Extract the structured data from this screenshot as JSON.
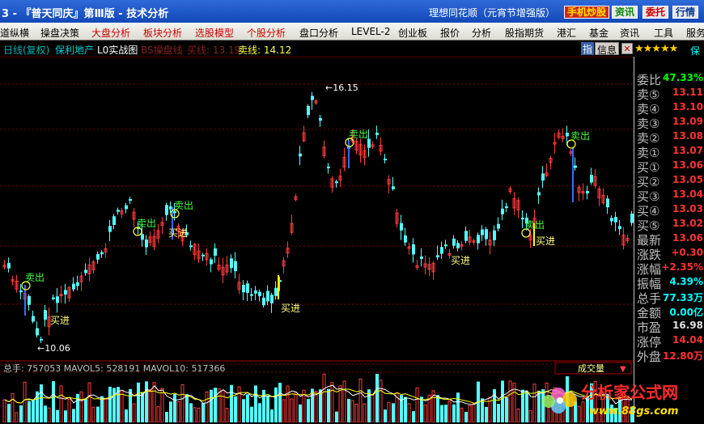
{
  "titlebar": {
    "title": "3 - 『普天同庆』第Ⅲ版 - 技术分析",
    "app_title": "理想同花顺（元宵节增强版）",
    "buttons": [
      "手机炒股",
      "资讯",
      "委托",
      "行情"
    ]
  },
  "menu": [
    "道纵横",
    "操盘决策",
    "大盘分析",
    "板块分析",
    "选股模型",
    "个股分析",
    "盘口分析",
    "LEVEL-2",
    "创业板",
    "报价",
    "分析",
    "股指期货",
    "港汇",
    "基金",
    "资讯",
    "工具",
    "服务"
  ],
  "menu_colors": {
    "default": "#000000",
    "highlight": "#cc0000",
    "highlight_items": [
      "大盘分析",
      "板块分析",
      "选股模型",
      "个股分析"
    ]
  },
  "chart_header": {
    "period": "日线(复权)",
    "stock_name": "保利地产",
    "indicator_name": "L0实战图",
    "bs_label": "BS操盘线",
    "buy_line_label": "买线: 13.19",
    "sell_line_label": "卖线: 14.12",
    "info_button": "信息",
    "zhi_button": "指"
  },
  "chart_annotations": {
    "high": "16.15",
    "low": "10.06",
    "signals": [
      {
        "text": "卖出"
      },
      {
        "text": "买进"
      },
      {
        "text": "卖出"
      },
      {
        "text": "卖出"
      },
      {
        "text": "买进"
      },
      {
        "text": "买进"
      },
      {
        "text": "卖出"
      },
      {
        "text": "买进"
      },
      {
        "text": "卖出"
      },
      {
        "text": "买进"
      },
      {
        "text": "卖出"
      }
    ]
  },
  "volume_header": {
    "label": "总手: 757053 MAVOL5: 528191 MAVOL10: 517366",
    "selector": "成交量"
  },
  "quote_panel": {
    "stars": "★★★★★",
    "stars_suffix": "保",
    "rows": [
      {
        "label": "委比",
        "value": "47.33%",
        "color": "#00ff00"
      },
      {
        "label": "卖⑤",
        "value": "13.11",
        "color": "#ff3232"
      },
      {
        "label": "卖④",
        "value": "13.10",
        "color": "#ff3232"
      },
      {
        "label": "卖③",
        "value": "13.09",
        "color": "#ff3232"
      },
      {
        "label": "卖②",
        "value": "13.08",
        "color": "#ff3232"
      },
      {
        "label": "卖①",
        "value": "13.07",
        "color": "#ff3232"
      },
      {
        "label": "买①",
        "value": "13.06",
        "color": "#ff3232"
      },
      {
        "label": "买②",
        "value": "13.05",
        "color": "#ff3232"
      },
      {
        "label": "买③",
        "value": "13.04",
        "color": "#ff3232"
      },
      {
        "label": "买④",
        "value": "13.03",
        "color": "#ff3232"
      },
      {
        "label": "买⑤",
        "value": "13.02",
        "color": "#ff3232"
      },
      {
        "label": "最新",
        "value": "13.06",
        "color": "#ff3232"
      },
      {
        "label": "涨跌",
        "value": "+0.30",
        "color": "#ff3232"
      },
      {
        "label": "涨幅",
        "value": "+2.35%",
        "color": "#ff3232"
      },
      {
        "label": "振幅",
        "value": "4.39%",
        "color": "#00ffff"
      },
      {
        "label": "总手",
        "value": "77.33万",
        "color": "#00ffff"
      },
      {
        "label": "金额",
        "value": "0.00亿",
        "color": "#00ffff"
      },
      {
        "label": "市盈",
        "value": "16.98",
        "color": "#e0e0e0"
      },
      {
        "label": "涨停",
        "value": "14.04",
        "color": "#ff3232"
      },
      {
        "label": "外盘",
        "value": "12.80万",
        "color": "#ff3232"
      }
    ]
  },
  "watermark": {
    "name": "分析家公式网",
    "url": "www.88gs.com"
  }
}
